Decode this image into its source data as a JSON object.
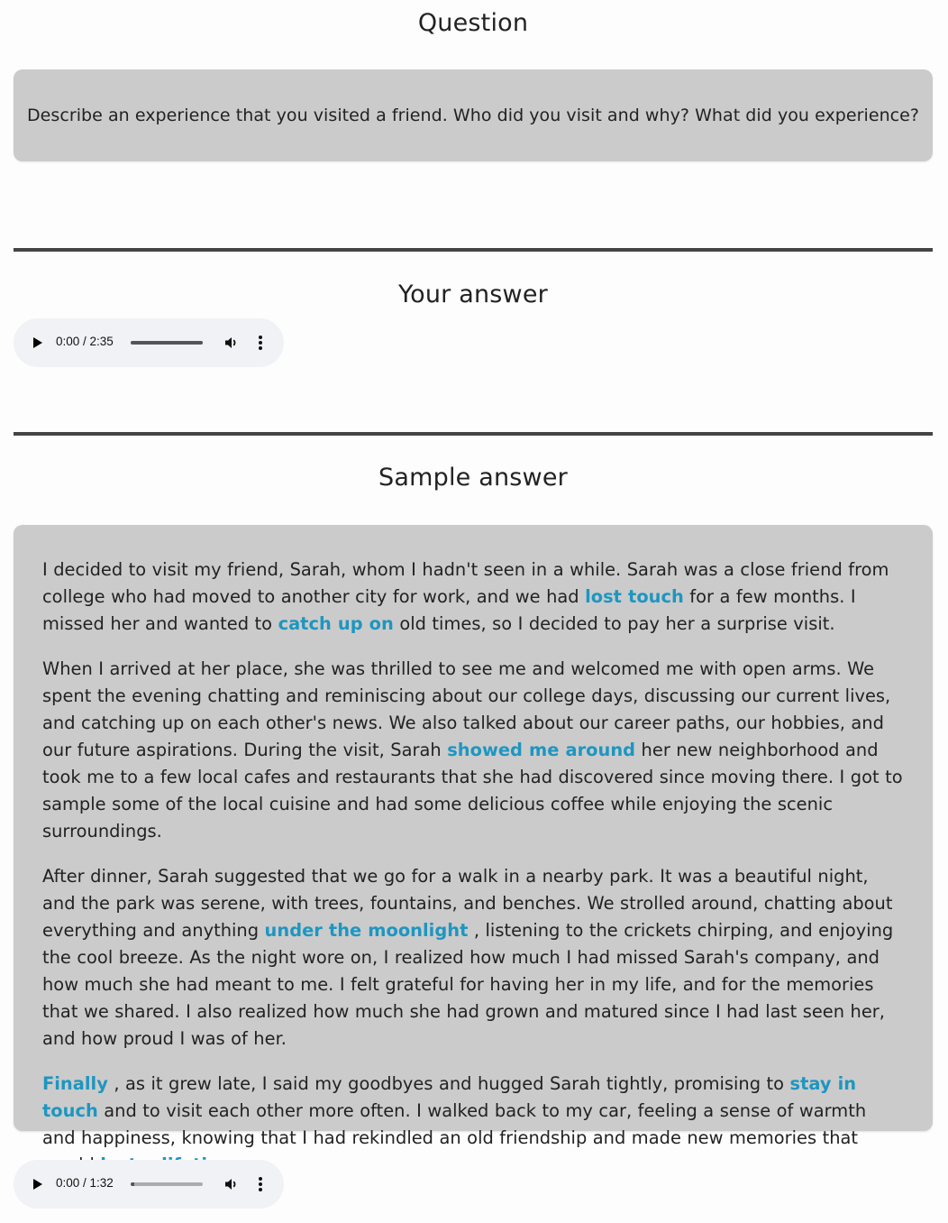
{
  "question_section": {
    "title": "Question",
    "text": "Describe an experience that you visited a friend. Who did you visit and why? What did you experience?"
  },
  "your_answer_section": {
    "title": "Your answer",
    "audio": {
      "current_time": "0:00",
      "duration": "2:35",
      "time_display": "0:00 / 2:35",
      "progress_fraction": 0,
      "buffered_fraction": 1.0,
      "play_icon": "play-icon",
      "volume_icon": "volume-icon",
      "more_icon": "more-vertical-icon"
    }
  },
  "sample_answer_section": {
    "title": "Sample answer",
    "highlight_color": "#1e96c0",
    "paragraphs": [
      [
        {
          "text": "I decided to visit my friend, Sarah, whom I hadn't seen in a while. Sarah was a close friend from college who had moved to another city for work, and we had "
        },
        {
          "text": "lost touch",
          "highlight": true
        },
        {
          "text": " for a few months. I missed her and wanted to "
        },
        {
          "text": "catch up on",
          "highlight": true
        },
        {
          "text": " old times, so I decided to pay her a surprise visit."
        }
      ],
      [
        {
          "text": "When I arrived at her place, she was thrilled to see me and welcomed me with open arms. We spent the evening chatting and reminiscing about our college days, discussing our current lives, and catching up on each other's news. We also talked about our career paths, our hobbies, and our future aspirations. During the visit, Sarah "
        },
        {
          "text": "showed me around",
          "highlight": true
        },
        {
          "text": " her new neighborhood and took me to a few local cafes and restaurants that she had discovered since moving there. I got to sample some of the local cuisine and had some delicious coffee while enjoying the scenic surroundings."
        }
      ],
      [
        {
          "text": "After dinner, Sarah suggested that we go for a walk in a nearby park. It was a beautiful night, and the park was serene, with trees, fountains, and benches. We strolled around, chatting about everything and anything "
        },
        {
          "text": "under the moonlight",
          "highlight": true
        },
        {
          "text": " , listening to the crickets chirping, and enjoying the cool breeze. As the night wore on, I realized how much I had missed Sarah's company, and how much she had meant to me. I felt grateful for having her in my life, and for the memories that we shared. I also realized how much she had grown and matured since I had last seen her, and how proud I was of her."
        }
      ],
      [
        {
          "text": "Finally",
          "highlight": true
        },
        {
          "text": " , as it grew late, I said my goodbyes and hugged Sarah tightly, promising to "
        },
        {
          "text": "stay in touch",
          "highlight": true
        },
        {
          "text": " and to visit each other more often. I walked back to my car, feeling a sense of warmth and happiness, knowing that I had rekindled an old friendship and made new memories that would "
        },
        {
          "text": "last a lifetime",
          "highlight": true
        },
        {
          "text": " ."
        }
      ]
    ],
    "audio": {
      "current_time": "0:00",
      "duration": "1:32",
      "time_display": "0:00 / 1:32",
      "progress_fraction": 0,
      "buffered_fraction": 0.05,
      "play_icon": "play-icon",
      "volume_icon": "volume-icon",
      "more_icon": "more-vertical-icon"
    }
  }
}
